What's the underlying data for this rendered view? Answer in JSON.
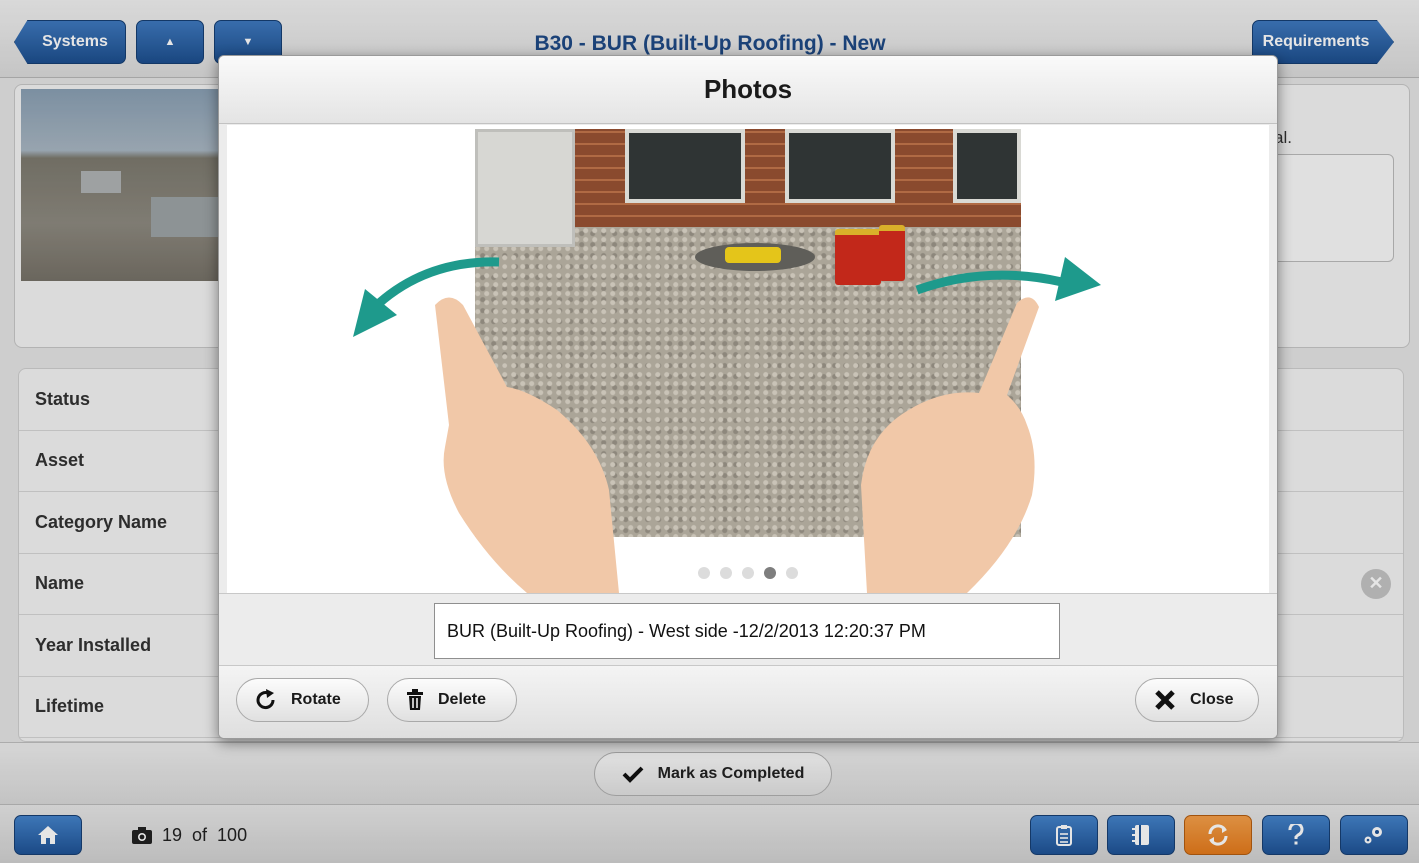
{
  "header": {
    "systems_label": "Systems",
    "up_arrow": "▲",
    "down_arrow": "▼",
    "title": "B30 - BUR (Built-Up Roofing) - New",
    "requirements_label": "Requirements"
  },
  "background": {
    "partial_text": "al.",
    "fields": [
      {
        "label": "Status"
      },
      {
        "label": "Asset"
      },
      {
        "label": "Category Name"
      },
      {
        "label": "Name"
      },
      {
        "label": "Year Installed"
      },
      {
        "label": "Lifetime"
      }
    ],
    "clear_icon": "✕",
    "mark_completed_label": "Mark as Completed"
  },
  "modal": {
    "title": "Photos",
    "caption": "BUR (Built-Up Roofing) - West side -12/2/2013 12:20:37 PM",
    "dots_total": 5,
    "active_dot": 4,
    "rotate_label": "Rotate",
    "delete_label": "Delete",
    "close_label": "Close"
  },
  "footer": {
    "photo_count_current": "19",
    "photo_count_of": "of",
    "photo_count_total": "100"
  },
  "colors": {
    "nav_blue": "#1d4f8f",
    "title_blue": "#1f4a86",
    "sync_orange": "#e57b1c",
    "swipe_arrow": "#1e9a8c",
    "hand_skin": "#f1c8a8"
  },
  "icons": [
    "home-icon",
    "camera-icon",
    "clipboard-icon",
    "notebook-icon",
    "sync-icon",
    "help-icon",
    "settings-icon",
    "rotate-icon",
    "trash-icon",
    "close-icon",
    "checkmark-icon"
  ]
}
